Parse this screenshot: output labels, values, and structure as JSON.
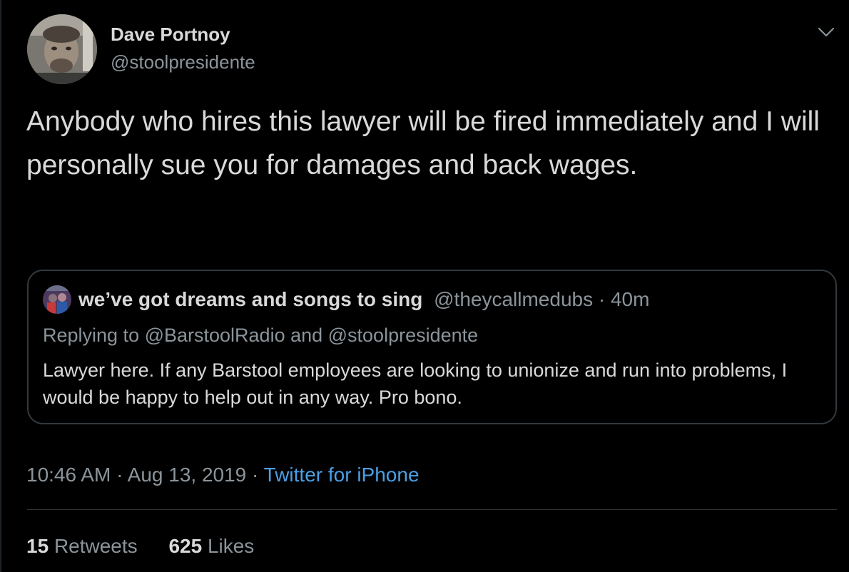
{
  "author": {
    "name": "Dave Portnoy",
    "handle": "@stoolpresidente"
  },
  "tweet": {
    "text": "Anybody who hires this lawyer will be  fired immediately and I will personally sue you for damages and back wages."
  },
  "quoted_tweet": {
    "name": "we’ve got dreams and songs to sing",
    "handle": "@theycallmedubs",
    "separator": " · ",
    "time": "40m",
    "replying_to": "Replying to @BarstoolRadio and @stoolpresidente",
    "text": "Lawyer here. If any Barstool employees are looking to unionize and run into problems, I would be  happy to help out in any way. Pro bono."
  },
  "meta": {
    "time": "10:46 AM",
    "separator": " · ",
    "date": "Aug 13, 2019",
    "source": "Twitter for iPhone"
  },
  "stats": {
    "retweets_count": "15",
    "retweets_label": "Retweets",
    "likes_count": "625",
    "likes_label": "Likes"
  },
  "icons": {
    "menu": "chevron-down-icon"
  },
  "colors": {
    "background": "#000000",
    "text": "#d9d9d9",
    "secondary": "#8b949a",
    "link": "#4aa0e6",
    "border": "#33393e"
  }
}
